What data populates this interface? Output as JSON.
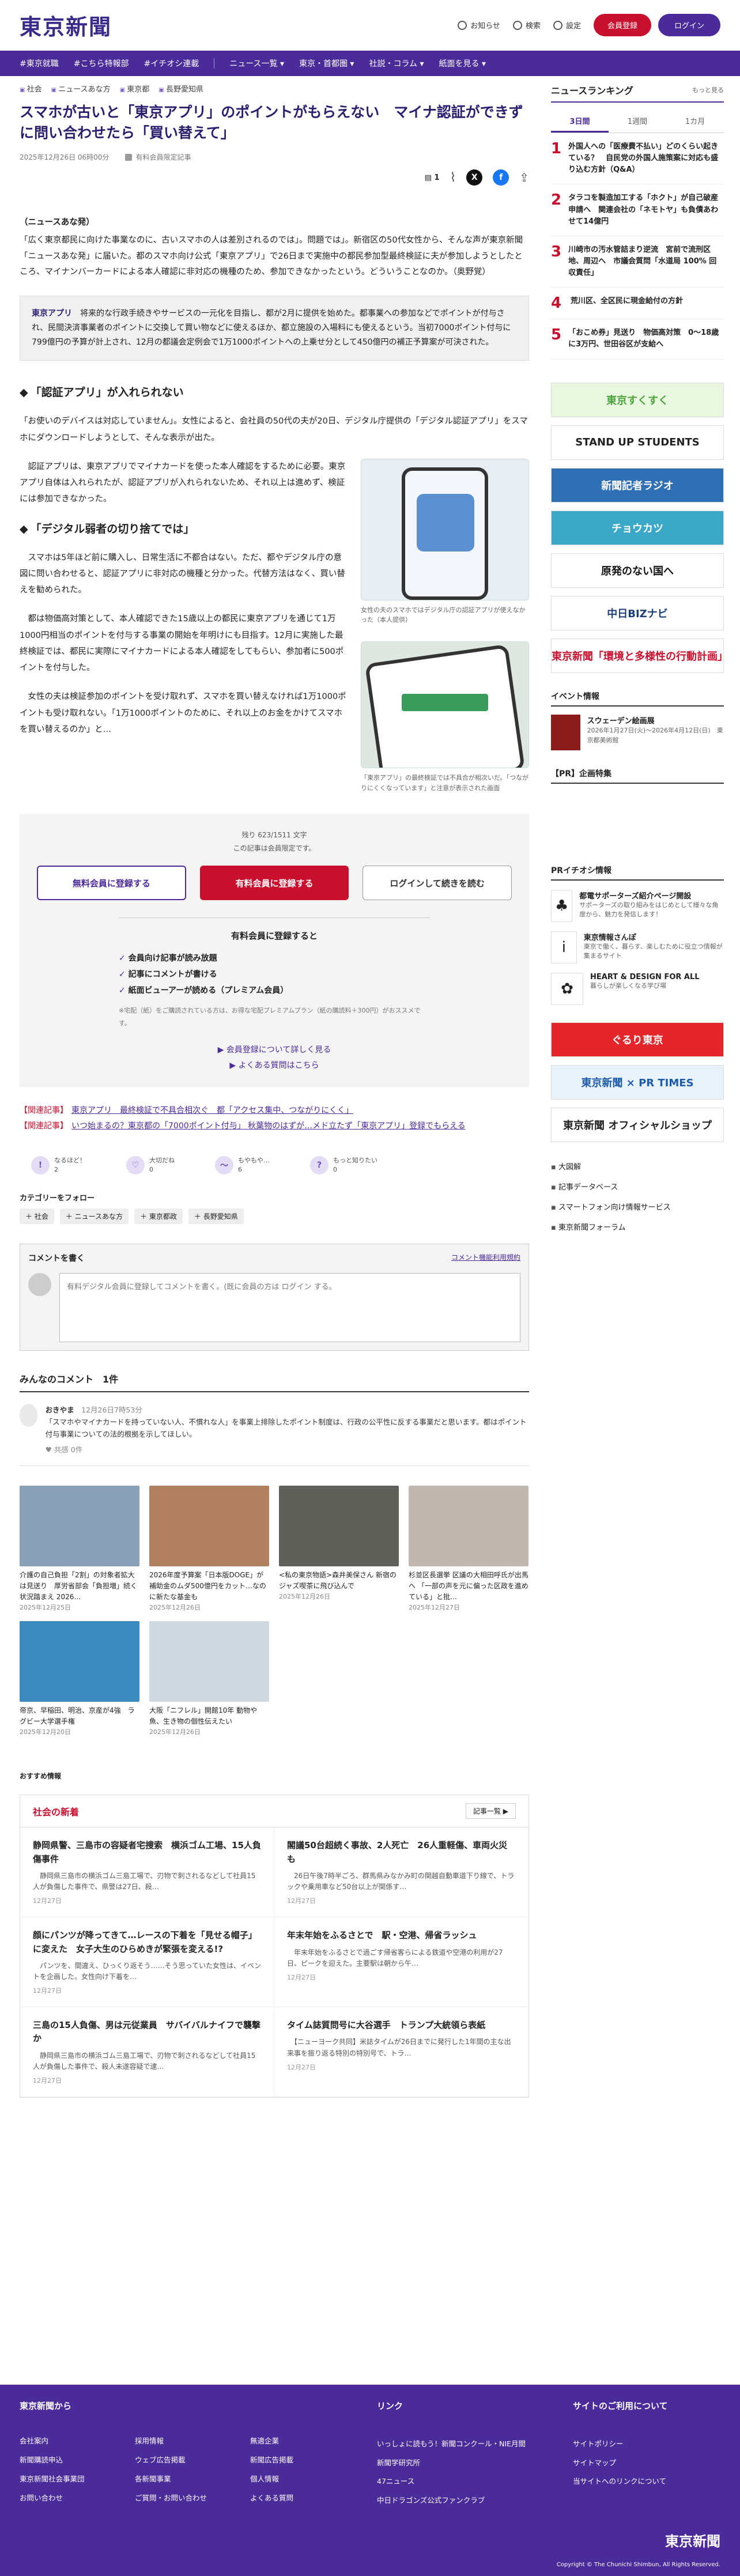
{
  "header": {
    "logo": "東京新聞",
    "notify": "お知らせ",
    "search": "検索",
    "settings": "設定",
    "register": "会員登録",
    "login": "ログイン"
  },
  "nav": [
    "#東京就職",
    "#こちら特報部",
    "#イチオシ連載",
    "ニュース一覧 ▾",
    "東京・首都圏 ▾",
    "社説・コラム ▾",
    "紙面を見る ▾"
  ],
  "article": {
    "tags": [
      "社会",
      "ニュースあな方",
      "東京都",
      "長野愛知県"
    ],
    "title": "スマホが古いと「東京アプリ」のポイントがもらえない　マイナ認証ができずに問い合わせたら「買い替えて」",
    "date": "2025年12月26日 06時00分",
    "member_badge": "有料会員限定記事",
    "comment_count": "1",
    "lead_label": "（ニュースあな発）",
    "lead": "「広く東京都民に向けた事業なのに、古いスマホの人は差別されるのでは」。問題では」。新宿区の50代女性から、そんな声が東京新聞「ニュースあな発」に届いた。都のスマホ向け公式「東京アプリ」で26日まで実施中の都民参加型最終検証に夫が参加しようとしたところ、マイナンバーカードによる本人確認に非対応の機種のため、参加できなかったという。どういうことなのか。（奥野覚）",
    "summary_key": "東京アプリ",
    "summary": "　将来的な行政手続きやサービスの一元化を目指し、都が2月に提供を始めた。都事業への参加などでポイントが付与され、民間決済事業者のポイントに交換して買い物などに使えるほか、都立施設の入場料にも使えるという。当初7000ポイント付与に799億円の予算が計上され、12月の都議会定例会で1万1000ポイントへの上乗せ分として450億円の補正予算案が可決された。",
    "h1": "「認証アプリ」が入れられない",
    "p1": "「お使いのデバイスは対応していません」。女性によると、会社員の50代の夫が20日、デジタル庁提供の「デジタル認証アプリ」をスマホにダウンロードしようとして、そんな表示が出た。",
    "p2": "　認証アプリは、東京アプリでマイナカードを使った本人確認をするために必要。東京アプリ自体は入れられたが、認証アプリが入れられないため、それ以上は進めず、検証には参加できなかった。",
    "h2": "「デジタル弱者の切り捨てでは」",
    "p3": "　スマホは5年ほど前に購入し、日常生活に不都合はない。ただ、都やデジタル庁の意図に問い合わせると、認証アプリに非対応の機種と分かった。代替方法はなく、買い替えを勧められた。",
    "p4": "　都は物価高対策として、本人確認できた15歳以上の都民に東京アプリを通じて1万1000円相当のポイントを付与する事業の開始を年明けにも目指す。12月に実施した最終検証では、都民に実際にマイナカードによる本人確認をしてもらい、参加者に500ポイントを付与した。",
    "p5": "　女性の夫は検証参加のポイントを受け取れず、スマホを買い替えなければ1万1000ポイントも受け取れない。「1万1000ポイントのために、それ以上のお金をかけてスマホを買い替えるのか」と…",
    "caption1": "女性の夫のスマホではデジタル庁の認証アプリが使えなかった（本人提供）",
    "caption2": "「東京アプリ」の最終検証では不具合が相次いだ。「つながりにくくなっています」と注意が表示された画面"
  },
  "paywall": {
    "remaining": "残り 623/1511 文字",
    "notice": "この記事は会員限定です。",
    "free_btn": "無料会員に登録する",
    "paid_btn": "有料会員に登録する",
    "login_btn": "ログインして続きを読む",
    "benefits_head": "有料会員に登録すると",
    "benefits": [
      "会員向け記事が読み放題",
      "記事にコメントが書ける",
      "紙面ビューアーが読める（プレミアム会員）"
    ],
    "note": "※宅配（紙）をご購読されている方は、お得な宅配プレミアムプラン（紙の購読料＋300円）がおススメです。",
    "link1": "▶ 会員登録について詳しく見る",
    "link2": "▶ よくある質問はこちら"
  },
  "related": [
    {
      "k": "【関連記事】",
      "t": "東京アプリ　最終検証で不具合相次ぐ　都「アクセス集中、つながりにくく」"
    },
    {
      "k": "【関連記事】",
      "t": "いつ始まるの？東京都の「7000ポイント付与」 秋葉物のはずが…メド立たず「東京アプリ」登録でもらえる"
    }
  ],
  "reactions": [
    {
      "icon": "!",
      "label": "なるほど！",
      "count": "2"
    },
    {
      "icon": "♡",
      "label": "大切だね",
      "count": "0"
    },
    {
      "icon": "～",
      "label": "もやもや…",
      "count": "6"
    },
    {
      "icon": "?",
      "label": "もっと知りたい",
      "count": "0"
    }
  ],
  "category": {
    "label": "カテゴリーをフォロー",
    "chips": [
      "＋ 社会",
      "＋ ニュースあな方",
      "＋ 東京都政",
      "＋ 長野愛知県"
    ]
  },
  "comment_box": {
    "title": "コメントを書く",
    "rules": "コメント機能利用規約",
    "prompt": "有料デジタル会員に登録してコメントを書く。(既に会員の方は ログイン する。"
  },
  "comments": {
    "title": "みんなのコメント　1件",
    "user": "おきやま",
    "date": "12月26日7時53分",
    "body": "「スマホやマイナカードを持っていない人、不慣れな人」を事業上排除したポイント制度は、行政の公平性に反する事業だと思います。都はポイント付与事業についての法的根拠を示してほしい。",
    "likes": "0件"
  },
  "thumbs": [
    {
      "t": "介護の自己負担「2割」の対象者拡大は見送り　厚労省部会「負担増」続く状況踏まえ 2026…",
      "d": "2025年12月25日",
      "c": "#8aa0b8"
    },
    {
      "t": "2026年度予算案「日本版DOGE」が補助金のムダ500億円をカット…なのに新たな基金も",
      "d": "2025年12月26日",
      "c": "#b08060"
    },
    {
      "t": "<私の東京物語>森井美保さん 新宿のジャズ喫茶に飛び込んで",
      "d": "2025年12月26日",
      "c": "#60605a"
    },
    {
      "t": "杉並区長選挙 区議の大相田呼氏が出馬へ 「一部の声を元に偏った区政を進めている」と批…",
      "d": "2025年12月27日",
      "c": "#c0b8b0"
    },
    {
      "t": "帝京、早稲田、明治、京産が4強　ラグビー大学選手権",
      "d": "2025年12月20日",
      "c": "#3a8ac0"
    },
    {
      "t": "大阪「ニフレル」開館10年 動物や魚、生き物の個性伝えたい",
      "d": "2025年12月26日",
      "c": "#d0d8e0"
    }
  ],
  "recommend": "おすすめ情報",
  "social": {
    "title": "社会の新着",
    "more": "記事一覧 ▶",
    "items": [
      {
        "t": "静岡県警、三島市の容疑者宅捜索　横浜ゴム工場、15人負傷事件",
        "x": "　静岡県三島市の横浜ゴム三島工場で、刃物で刺されるなどして社員15人が負傷した事件で、県警は27日、殺…",
        "d": "12月27日"
      },
      {
        "t": "閣議50台超続く事故、2人死亡　26人重軽傷、車両火災も",
        "x": "　26日午後7時半ごろ、群馬県みなかみ町の関越自動車道下り線で、トラックや乗用車など50台以上が関係す…",
        "d": "12月27日"
      },
      {
        "t": "顔にパンツが降ってきて…レースの下着を「見せる帽子」に変えた　女子大生のひらめきが緊張を変える!?",
        "x": "　パンツを、間違え、ひっくり返そう……そう思っていた女性は、イベントを企画した。女性向け下着を…",
        "d": "12月27日"
      },
      {
        "t": "年末年始をふるさとで　駅・空港、帰省ラッシュ",
        "x": "　年末年始をふるさとで過ごす帰省客らによる鉄道や空港の利用が27日、ピークを迎えた。主要駅は朝から午…",
        "d": "12月27日"
      },
      {
        "t": "三島の15人負傷、男は元従業員　サバイバルナイフで襲撃か",
        "x": "　静岡県三島市の横浜ゴム三島工場で、刃物で刺されるなどして社員15人が負傷した事件で、殺人未遂容疑で逮…",
        "d": "12月27日"
      },
      {
        "t": "タイム誌質問号に大谷選手　トランプ大統領ら表紙",
        "x": "　【ニューヨーク共同】米誌タイムが26日までに発行した1年間の主な出来事を振り返る特別の特別号で、トラ…",
        "d": "12月27日"
      }
    ]
  },
  "sidebar": {
    "ranking_title": "ニュースランキング",
    "ranking_more": "もっと見る",
    "tabs": [
      "3日間",
      "1週間",
      "1カ月"
    ],
    "ranks": [
      {
        "n": "1",
        "t": "外国人への「医療費不払い」どのくらい起きている？　自民党の外国人施策案に対応も盛り込む方針（Q&A）"
      },
      {
        "n": "2",
        "t": "タラコを製造加工する「ホクト」が自己破産申請へ　関連会社の「ネモトヤ」も負債あわせて14億円"
      },
      {
        "n": "3",
        "t": "川崎市の汚水管詰まり逆流　宮前で流刑区地、周辺へ　市議会質問「水道局 100% 回収責任」"
      },
      {
        "n": "4",
        "t": "荒川区、全区民に現金給付の方針"
      },
      {
        "n": "5",
        "t": "「おこめ券」見送り　物価高対策　0～18歳に3万円、世田谷区が支給へ"
      }
    ],
    "banners": [
      {
        "t": "東京すくすく",
        "c": "#e9f6e0",
        "f": "#4aa43a"
      },
      {
        "t": "STAND UP STUDENTS",
        "c": "#fff",
        "f": "#222"
      },
      {
        "t": "新聞記者ラジオ",
        "c": "#2f6fb4",
        "f": "#fff"
      },
      {
        "t": "チョウカツ",
        "c": "#3ca8c8",
        "f": "#fff"
      },
      {
        "t": "原発のない国へ",
        "c": "#fff",
        "f": "#111"
      },
      {
        "t": "中日BIZナビ",
        "c": "#fff",
        "f": "#1c3f7a"
      },
      {
        "t": "東京新聞「環境と多様性の行動計画」",
        "c": "#fff",
        "f": "#c8102e"
      }
    ],
    "event_title": "イベント情報",
    "event": {
      "t": "スウェーデン絵画展",
      "s": "2026年1月27日(火)～2026年4月12日(日)　東京都美術館"
    },
    "pr_title": "【PR】企画特集",
    "pr_sec": "PRイチオシ情報",
    "pr": [
      {
        "ic": "♣",
        "t": "都電サポーターズ紹介ページ開設",
        "s": "サポーターズの取り組みをはじめとして様々な角度から、魅力を発信します！"
      },
      {
        "ic": "i",
        "t": "東京情報さんぽ",
        "s": "東京で働く、暮らす、楽しむために役立つ情報が集まるサイト"
      },
      {
        "ic": "✿",
        "t": "HEART & DESIGN FOR ALL",
        "s": "暮らしが楽しくなる学び場"
      }
    ],
    "banners2": [
      {
        "t": "ぐるり東京",
        "c": "#e4262b",
        "f": "#fff"
      },
      {
        "t": "東京新聞 × PR TIMES",
        "c": "#e8f2fb",
        "f": "#1d5aa8"
      },
      {
        "t": "東京新聞 オフィシャルショップ",
        "c": "#fff",
        "f": "#222"
      }
    ],
    "links": [
      "大図解",
      "記事データベース",
      "スマートフォン向け情報サービス",
      "東京新聞フォーラム"
    ]
  },
  "footer": {
    "col1_title": "東京新聞から",
    "col1": [
      "会社案内",
      "採用情報",
      "無適企業",
      "新聞購読申込",
      "ウェブ広告掲載",
      "新聞広告掲載",
      "東京新聞社会事業団",
      "各新聞事業",
      "個人情報",
      "お問い合わせ",
      "ご質問・お問い合わせ",
      "よくある質問"
    ],
    "col2_title": "リンク",
    "col2": [
      "いっしょに読もう！新聞コンクール・NIE月間",
      "新聞学研究所",
      "47ニュース",
      "中日ドラゴンズ公式ファンクラブ"
    ],
    "col3_title": "サイトのご利用について",
    "col3": [
      "サイトポリシー",
      "サイトマップ",
      "当サイトへのリンクについて"
    ],
    "logo": "東京新聞",
    "copy": "Copyright © The Chunichi Shimbun, All Rights Reserved."
  }
}
